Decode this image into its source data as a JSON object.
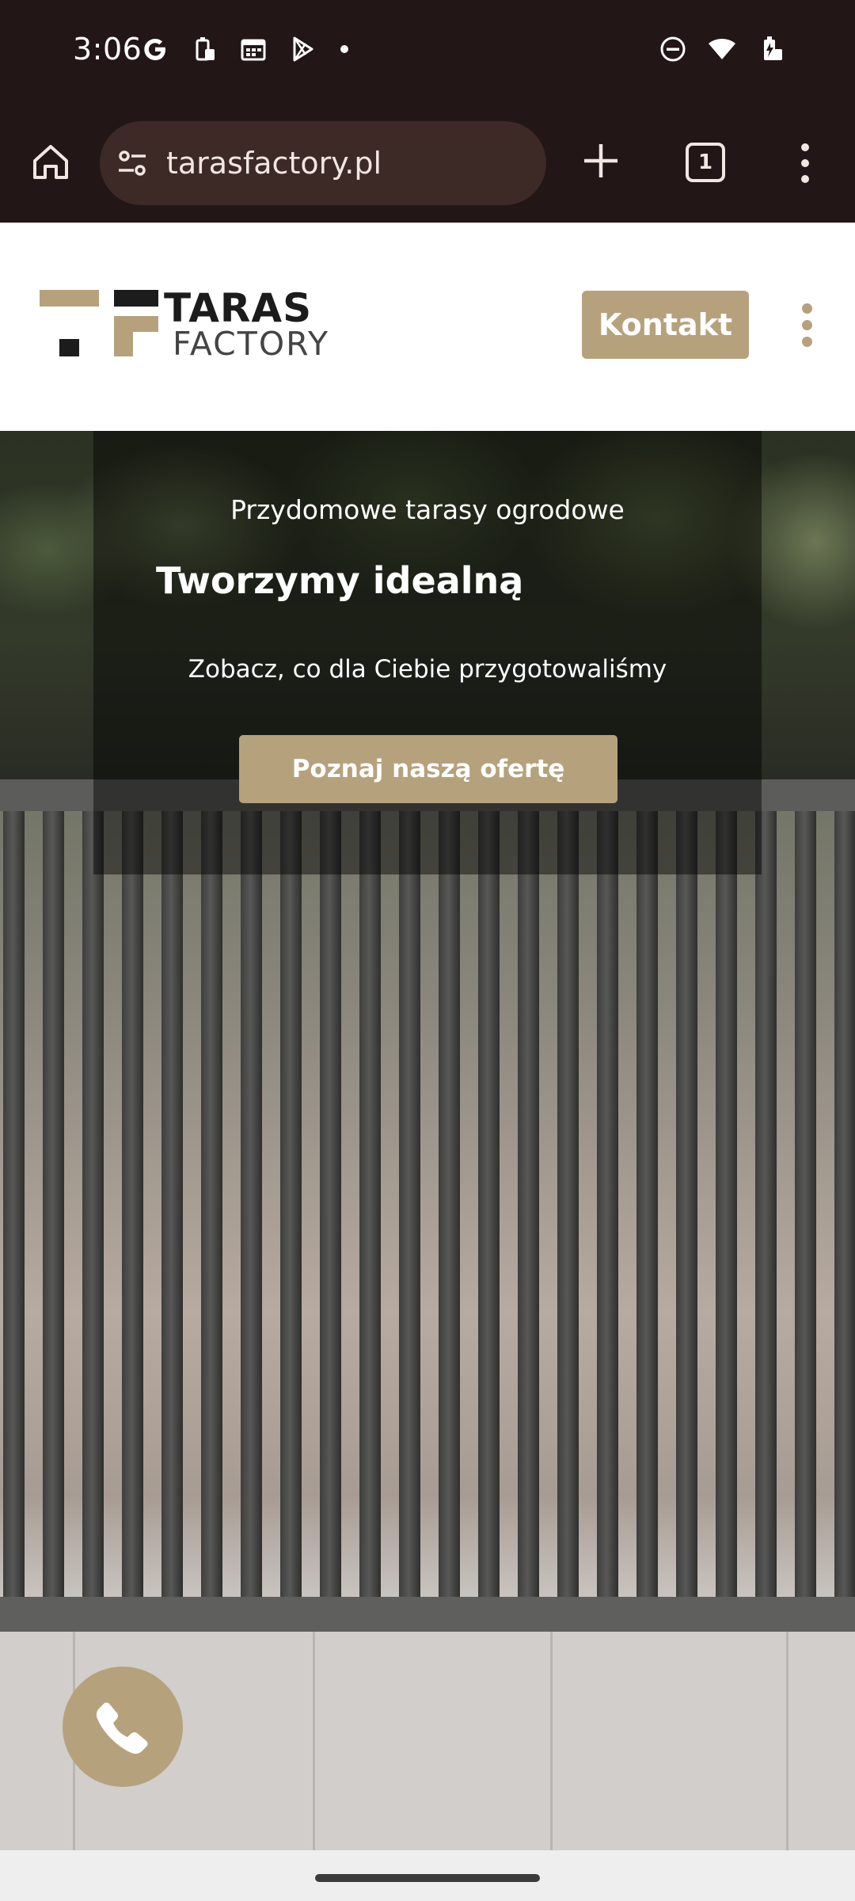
{
  "status_bar": {
    "time": "3:06",
    "left_icons": [
      "google-icon",
      "battery-saver-icon",
      "calendar-icon",
      "play-store-icon",
      "notification-dot"
    ],
    "right_icons": [
      "do-not-disturb-icon",
      "wifi-icon",
      "battery-charging-icon"
    ]
  },
  "browser": {
    "url": "tarasfactory.pl",
    "tab_count": "1"
  },
  "site_header": {
    "logo_line1": "TARAS",
    "logo_line2": "FACTORY",
    "contact_label": "Kontakt"
  },
  "hero": {
    "subtitle": "Przydomowe tarasy ogrodowe",
    "title": "Tworzymy idealną",
    "description": "Zobacz, co dla Ciebie przygotowaliśmy",
    "cta_label": "Poznaj naszą ofertę"
  },
  "colors": {
    "accent": "#b5a27d",
    "browser_chrome": "#231616",
    "url_pill": "#3d2a26"
  }
}
